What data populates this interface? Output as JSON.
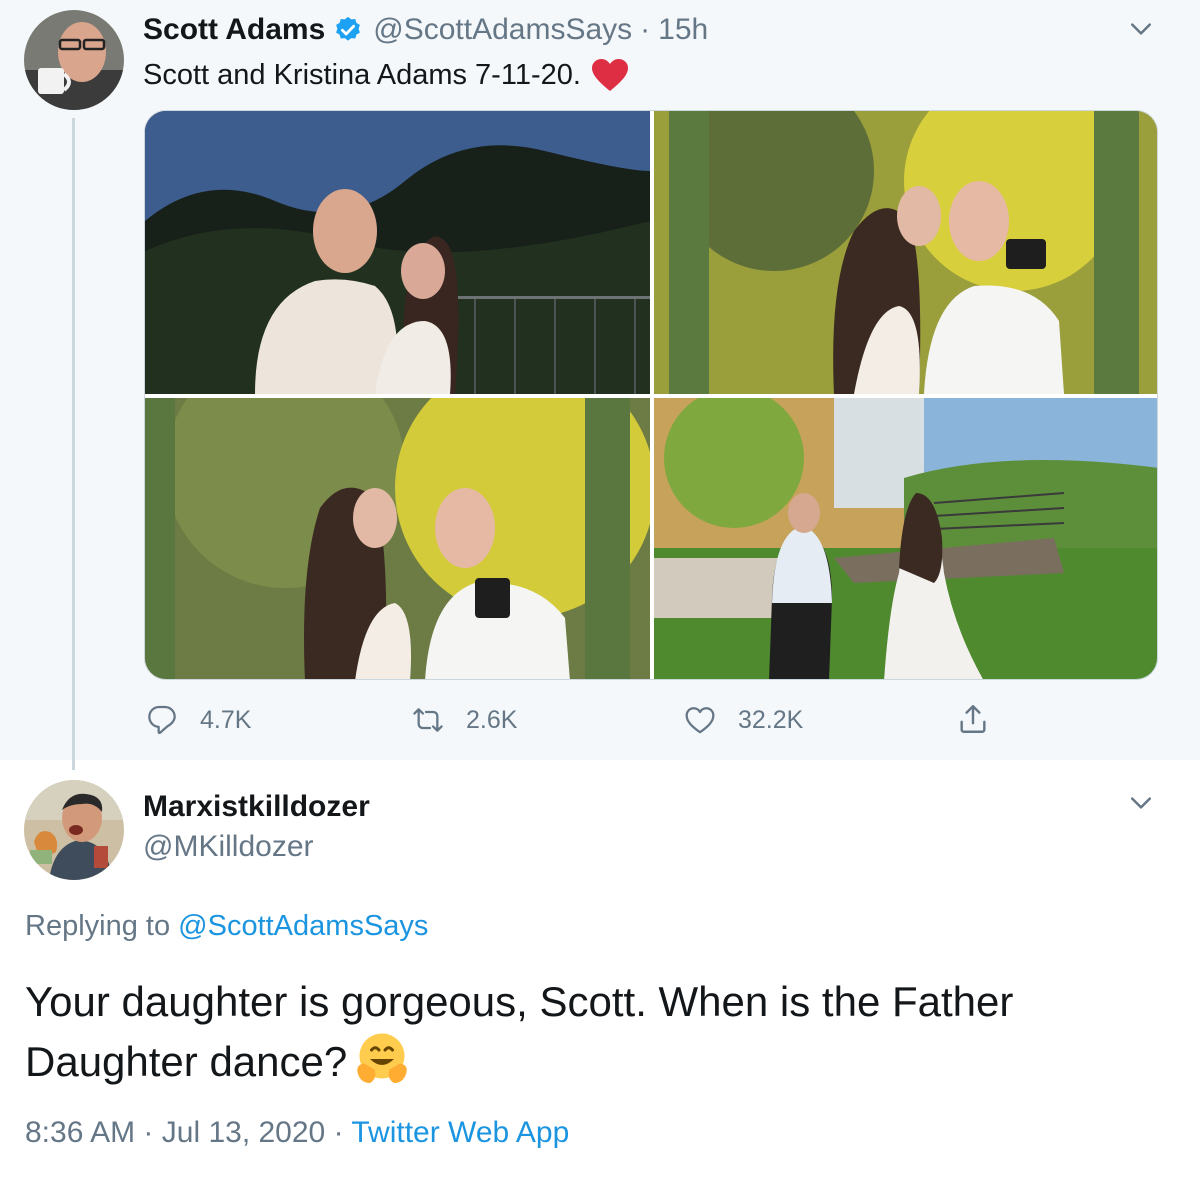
{
  "parent_tweet": {
    "author_name": "Scott Adams",
    "author_handle": "@ScottAdamsSays",
    "time_ago": "15h",
    "separator": "·",
    "text": "Scott and Kristina Adams 7-11-20.",
    "emoji": "heart-icon",
    "media_count": 4,
    "stats": {
      "replies": "4.7K",
      "retweets": "2.6K",
      "likes": "32.2K"
    }
  },
  "reply_tweet": {
    "author_name": "Marxistkilldozer",
    "author_handle": "@MKilldozer",
    "replying_to_label": "Replying to",
    "replying_to_handle": "@ScottAdamsSays",
    "text": "Your daughter is gorgeous, Scott. When is the Father Daughter dance?",
    "emoji": "hugging-face-icon",
    "time": "8:36 AM",
    "date": "Jul 13, 2020",
    "separator": "·",
    "source": "Twitter Web App"
  },
  "colors": {
    "link_blue": "#1b95e0",
    "secondary_text": "#657786",
    "primary_text": "#14171a",
    "parent_background": "#f5f8fa",
    "thread_line": "#ccd6dd",
    "heart_red": "#e0245e"
  }
}
